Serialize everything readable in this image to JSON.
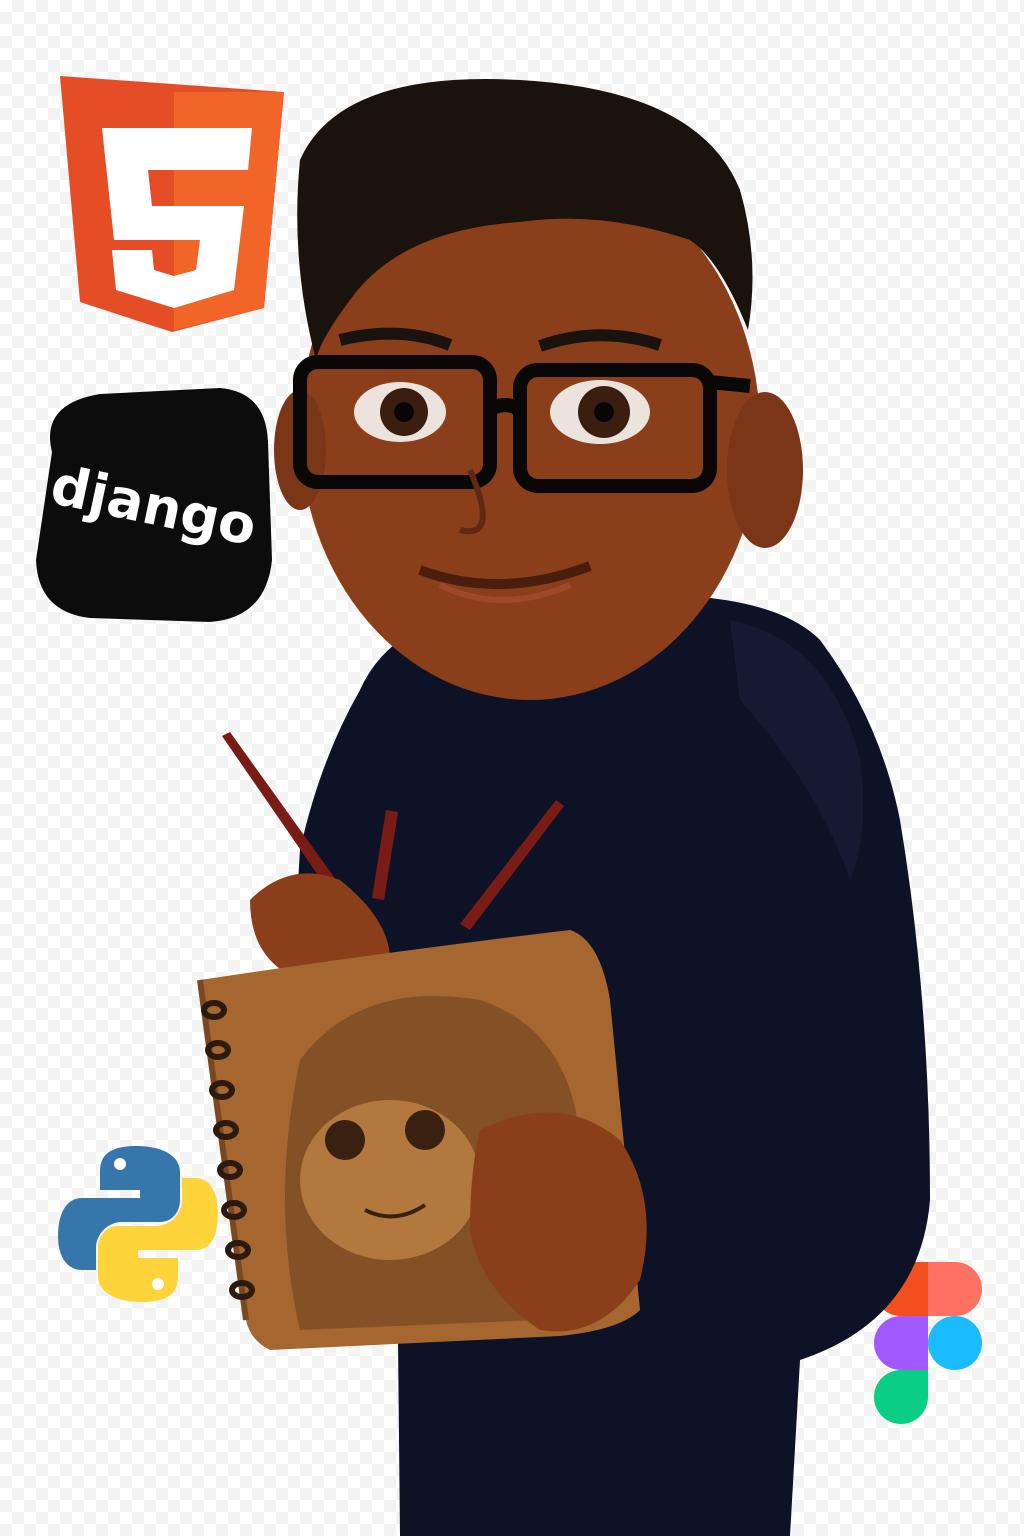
{
  "logos": {
    "html5": {
      "name": "html5-logo",
      "colors": {
        "primary": "#e44d26",
        "secondary": "#f16529",
        "shape": "#ffffff"
      }
    },
    "django": {
      "name": "django-logo",
      "label": "django",
      "colors": {
        "background": "#0c0c0c",
        "text": "#ffffff"
      }
    },
    "python": {
      "name": "python-logo",
      "colors": {
        "blue": "#3776ab",
        "yellow": "#ffd43b"
      }
    },
    "figma": {
      "name": "figma-logo",
      "colors": {
        "red": "#f24e1e",
        "orange": "#ff7262",
        "purple": "#a259ff",
        "blue": "#1abcfe",
        "green": "#0acf83"
      }
    }
  },
  "avatar": {
    "description_icons": [
      "glasses-icon",
      "hoodie-icon",
      "sketchbook-icon",
      "pencil-icon"
    ],
    "colors": {
      "skin": "#8a3f1a",
      "hair": "#1a120d",
      "hoodie": "#0e1226",
      "sketchbook": "#a5662f",
      "pencil": "#7a1c16"
    }
  }
}
